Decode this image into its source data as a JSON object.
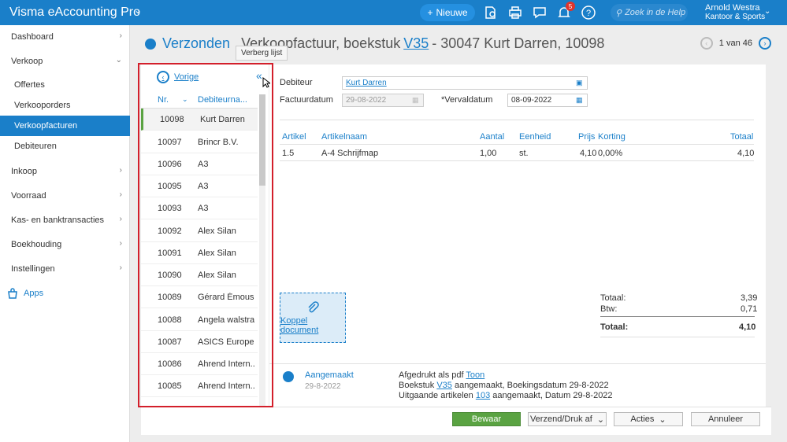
{
  "app": {
    "title": "Visma eAccounting Pro",
    "new_label": "Nieuwe",
    "search_placeholder": "Zoek in de Help",
    "notif_count": "5",
    "user_name": "Arnold Westra",
    "user_company": "Kantoor & Sports"
  },
  "sidebar": {
    "items": [
      {
        "label": "Dashboard"
      },
      {
        "label": "Verkoop"
      },
      {
        "label": "Offertes"
      },
      {
        "label": "Verkooporders"
      },
      {
        "label": "Verkoopfacturen"
      },
      {
        "label": "Debiteuren"
      },
      {
        "label": "Inkoop"
      },
      {
        "label": "Voorraad"
      },
      {
        "label": "Kas- en banktransacties"
      },
      {
        "label": "Boekhouding"
      },
      {
        "label": "Instellingen"
      },
      {
        "label": "Apps"
      }
    ]
  },
  "header": {
    "status": "Verzonden",
    "title_prefix": "Verkoopfactuur, boekstuk",
    "title_link": "V35",
    "title_suffix": "- 30047 Kurt Darren, 10098",
    "pager": "1 van 46"
  },
  "tooltip": "Verberg lijst",
  "list": {
    "prev_label": "Vorige",
    "col_nr": "Nr.",
    "col_name": "Debiteurna...",
    "rows": [
      {
        "nr": "10098",
        "name": "Kurt Darren"
      },
      {
        "nr": "10097",
        "name": "Brincr B.V."
      },
      {
        "nr": "10096",
        "name": "A3"
      },
      {
        "nr": "10095",
        "name": "A3"
      },
      {
        "nr": "10093",
        "name": "A3"
      },
      {
        "nr": "10092",
        "name": "Alex Silan"
      },
      {
        "nr": "10091",
        "name": "Alex Silan"
      },
      {
        "nr": "10090",
        "name": "Alex Silan"
      },
      {
        "nr": "10089",
        "name": "Gérard Émous..."
      },
      {
        "nr": "10088",
        "name": "Angela walstra"
      },
      {
        "nr": "10087",
        "name": "ASICS Europe"
      },
      {
        "nr": "10086",
        "name": "Ahrend Intern..."
      },
      {
        "nr": "10085",
        "name": "Ahrend Intern..."
      }
    ]
  },
  "form": {
    "debiteur_label": "Debiteur",
    "debiteur_value": "Kurt Darren",
    "factuurdatum_label": "Factuurdatum",
    "factuurdatum_value": "29-08-2022",
    "vervaldatum_label": "*Vervaldatum",
    "vervaldatum_value": "08-09-2022"
  },
  "lines": {
    "headers": {
      "artikel": "Artikel",
      "naam": "Artikelnaam",
      "aantal": "Aantal",
      "eenheid": "Eenheid",
      "prijs": "Prijs",
      "korting": "Korting",
      "totaal": "Totaal"
    },
    "row": {
      "artikel": "1.5",
      "naam": "A-4 Schrijfmap",
      "aantal": "1,00",
      "eenheid": "st.",
      "prijs": "4,10",
      "korting": "0,00%",
      "totaal": "4,10"
    }
  },
  "koppel_label": "Koppel document",
  "totals": {
    "totaal_label": "Totaal:",
    "totaal": "3,39",
    "btw_label": "Btw:",
    "btw": "0,71",
    "grand_label": "Totaal:",
    "grand": "4,10"
  },
  "history": {
    "status": "Aangemaakt",
    "date": "29-8-2022",
    "l1_text": "Afgedrukt als pdf",
    "l1_link": "Toon",
    "l2_a": "Boekstuk",
    "l2_link": "V35",
    "l2_b": "aangemaakt, Boekingsdatum 29-8-2022",
    "l3_a": "Uitgaande artikelen",
    "l3_link": "103",
    "l3_b": "aangemaakt, Datum 29-8-2022"
  },
  "footer": {
    "save": "Bewaar",
    "send": "Verzend/Druk af",
    "actions": "Acties",
    "cancel": "Annuleer"
  }
}
